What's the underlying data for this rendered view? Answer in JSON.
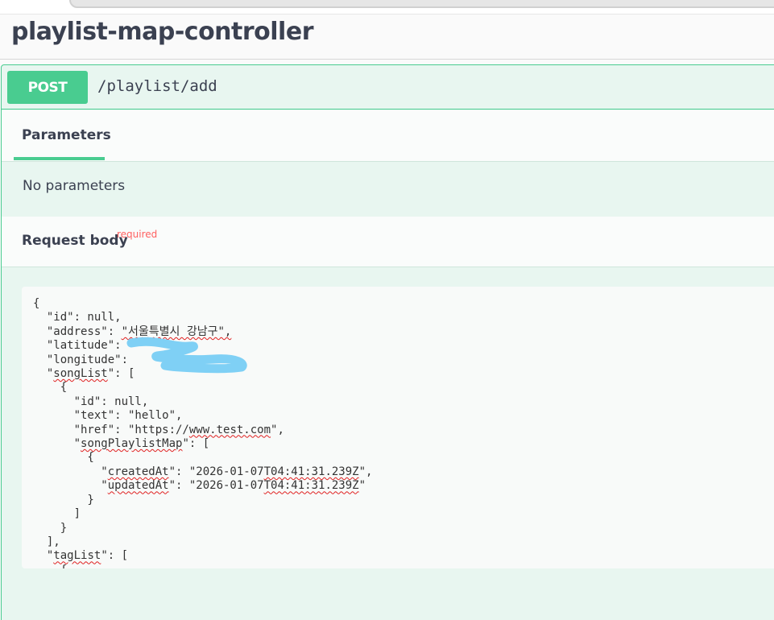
{
  "controller": {
    "title": "playlist-map-controller"
  },
  "operation": {
    "method": "POST",
    "path": "/playlist/add"
  },
  "parameters": {
    "tab_label": "Parameters",
    "empty_text": "No parameters"
  },
  "request_body": {
    "label": "Request body",
    "required_label": "required"
  },
  "body_json": {
    "open_brace": "{",
    "id_line": "  \"id\": null,",
    "address_key": "  \"address\": ",
    "address_value": "\"서울특별시 강남구\",",
    "latitude_key": "  \"latitude\": ",
    "longitude_key": "  \"longitude\": ",
    "songlist_pre": "  \"",
    "songlist_key": "songList",
    "songlist_post": "\": [",
    "item_open": "    {",
    "song_id_line": "      \"id\": null,",
    "song_text_line": "      \"text\": \"hello\",",
    "href_pre": "      \"href\": \"https://",
    "href_url": "www.test.com",
    "href_post": "\",",
    "map_pre": "      \"",
    "map_key": "songPlaylistMap",
    "map_post": "\": [",
    "map_item_open": "        {",
    "created_pre": "          \"",
    "created_key": "createdAt",
    "created_mid": "\": \"2026-01-07",
    "created_time": "T04:41:31.239Z",
    "created_post": "\",",
    "updated_pre": "          \"",
    "updated_key": "updatedAt",
    "updated_mid": "\": \"2026-01-07",
    "updated_time": "T04:41:31.239Z",
    "updated_post": "\"",
    "map_item_close": "        }",
    "map_close": "      ]",
    "item_close": "    }",
    "songlist_close": "  ],",
    "taglist_pre": "  \"",
    "taglist_key": "tagList",
    "taglist_post": "\": [",
    "tag_open": "    {"
  },
  "colors": {
    "post_green": "#49cc90",
    "required_red": "#ff6060",
    "squiggle": "#e02020",
    "redaction_blue": "#7fd0f5"
  }
}
